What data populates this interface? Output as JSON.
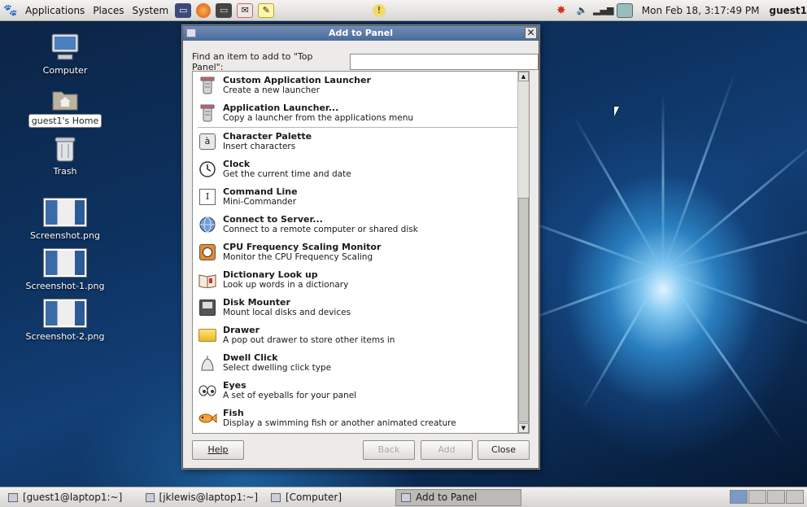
{
  "top_panel": {
    "menus": [
      "Applications",
      "Places",
      "System"
    ],
    "clock": "Mon Feb 18,  3:17:49 PM",
    "user": "guest1"
  },
  "desktop": {
    "icons": [
      {
        "label": "Computer",
        "icon": "computer-icon"
      },
      {
        "label": "guest1's Home",
        "icon": "home-folder-icon"
      },
      {
        "label": "Trash",
        "icon": "trash-icon"
      },
      {
        "label": "Screenshot.png",
        "icon": "image-icon"
      },
      {
        "label": "Screenshot-1.png",
        "icon": "image-icon"
      },
      {
        "label": "Screenshot-2.png",
        "icon": "image-icon"
      }
    ]
  },
  "dialog": {
    "title": "Add to Panel",
    "find_label": "Find an item to add to \"Top Panel\":",
    "find_value": "",
    "items": [
      {
        "title": "Custom Application Launcher",
        "desc": "Create a new launcher",
        "icon": "launcher-icon"
      },
      {
        "title": "Application Launcher...",
        "desc": "Copy a launcher from the applications menu",
        "icon": "launcher-icon"
      },
      {
        "title": "Character Palette",
        "desc": "Insert characters",
        "icon": "character-palette-icon"
      },
      {
        "title": "Clock",
        "desc": "Get the current time and date",
        "icon": "clock-icon"
      },
      {
        "title": "Command Line",
        "desc": "Mini-Commander",
        "icon": "command-line-icon"
      },
      {
        "title": "Connect to Server...",
        "desc": "Connect to a remote computer or shared disk",
        "icon": "network-server-icon"
      },
      {
        "title": "CPU Frequency Scaling Monitor",
        "desc": "Monitor the CPU Frequency Scaling",
        "icon": "cpu-monitor-icon"
      },
      {
        "title": "Dictionary Look up",
        "desc": "Look up words in a dictionary",
        "icon": "dictionary-icon"
      },
      {
        "title": "Disk Mounter",
        "desc": "Mount local disks and devices",
        "icon": "disk-icon"
      },
      {
        "title": "Drawer",
        "desc": "A pop out drawer to store other items in",
        "icon": "drawer-icon"
      },
      {
        "title": "Dwell Click",
        "desc": "Select dwelling click type",
        "icon": "dwell-click-icon"
      },
      {
        "title": "Eyes",
        "desc": "A set of eyeballs for your panel",
        "icon": "eyes-icon"
      },
      {
        "title": "Fish",
        "desc": "Display a swimming fish or another animated creature",
        "icon": "fish-icon"
      }
    ],
    "buttons": {
      "help": "Help",
      "back": "Back",
      "add": "Add",
      "close": "Close"
    }
  },
  "taskbar": {
    "tasks": [
      {
        "label": "[guest1@laptop1:~]",
        "active": false
      },
      {
        "label": "[jklewis@laptop1:~]",
        "active": false
      },
      {
        "label": "[Computer]",
        "active": false
      },
      {
        "label": "Add to Panel",
        "active": true
      }
    ]
  }
}
